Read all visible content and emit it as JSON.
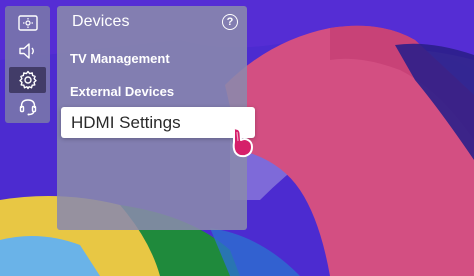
{
  "sidebar": {
    "icons": [
      {
        "name": "picture-icon"
      },
      {
        "name": "sound-icon"
      },
      {
        "name": "settings-gear-icon",
        "selected": true
      },
      {
        "name": "support-headset-icon"
      }
    ]
  },
  "menu": {
    "title": "Devices",
    "help_symbol": "?",
    "items": [
      {
        "label": "TV Management"
      },
      {
        "label": "External Devices"
      },
      {
        "label": "HDMI Settings",
        "focused": true
      }
    ]
  },
  "colors": {
    "wallpaper_purple": "#4c2bd0",
    "ribbon_pink": "#d34f82",
    "ribbon_yellow": "#e8c744",
    "ribbon_green": "#1f8a3c",
    "cursor_magenta": "#d61f6a"
  }
}
